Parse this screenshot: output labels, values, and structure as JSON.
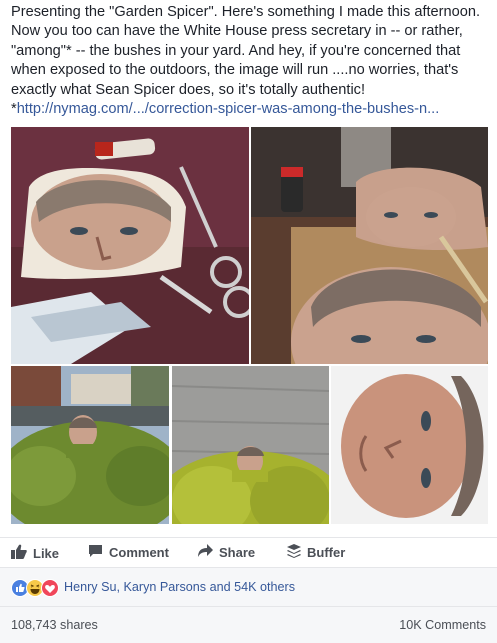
{
  "post": {
    "text": "Presenting the \"Garden Spicer\". Here's something I made this afternoon.\nNow you too can have the White House press secretary in -- or rather,\n\"among\"* -- the bushes in your yard. And hey, if you're concerned that\nwhen exposed to the outdoors, the image will run ....no worries, that's\nexactly what Sean Spicer does, so it's totally authentic!",
    "link_prefix": "*",
    "link": "http://nymag.com/.../correction-spicer-was-among-the-bushes-n..."
  },
  "photos": [
    {
      "name": "photo-cutout-with-scissors"
    },
    {
      "name": "photo-cutout-on-stick"
    },
    {
      "name": "photo-spicer-in-hedge-street"
    },
    {
      "name": "photo-spicer-in-bush-wall"
    },
    {
      "name": "photo-rotated-face-closeup"
    }
  ],
  "actions": {
    "like": "Like",
    "comment": "Comment",
    "share": "Share",
    "buffer": "Buffer"
  },
  "reactions": {
    "text": "Henry Su, Karyn Parsons and 54K others",
    "icons": [
      "like-reaction-icon",
      "haha-reaction-icon",
      "love-reaction-icon"
    ]
  },
  "stats": {
    "shares": "108,743 shares",
    "comments": "10K Comments"
  },
  "colors": {
    "link": "#365899",
    "action_text": "#4b4f56",
    "like_blue": "#3b5998"
  }
}
